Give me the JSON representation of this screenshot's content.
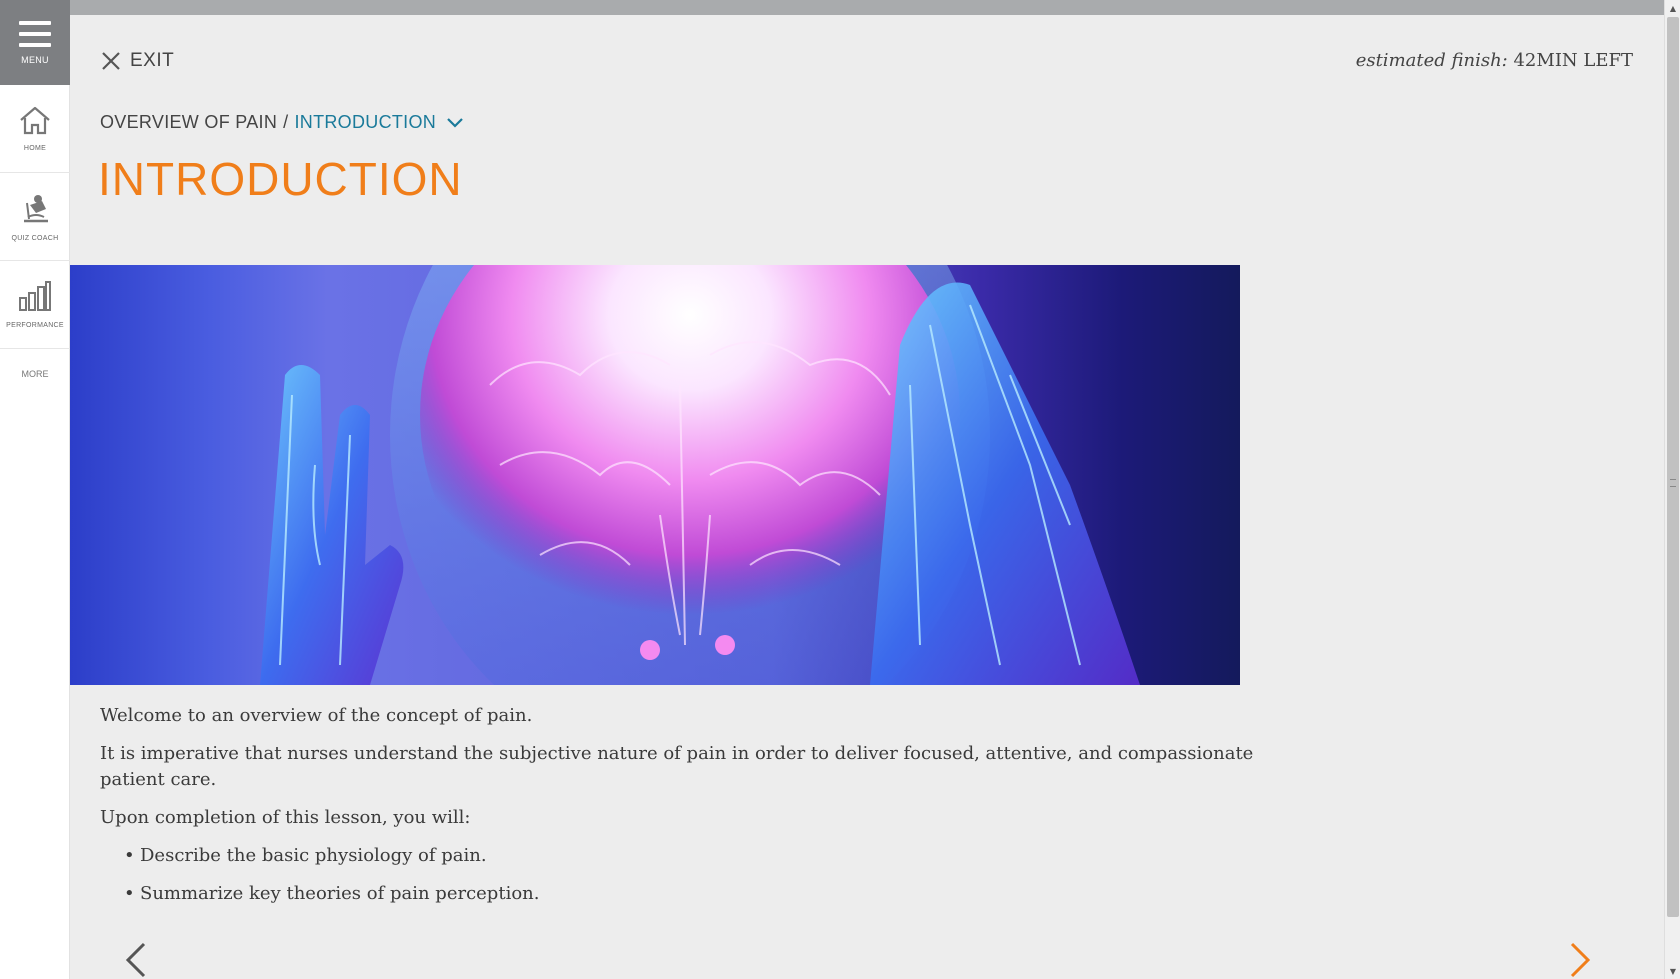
{
  "sidebar": {
    "menu_label": "MENU",
    "items": [
      {
        "label": "HOME",
        "icon": "home-icon"
      },
      {
        "label": "QUIZ COACH",
        "icon": "quiz-coach-icon"
      },
      {
        "label": "PERFORMANCE",
        "icon": "bar-chart-icon"
      }
    ],
    "more_label": "MORE"
  },
  "header": {
    "exit_label": "EXIT",
    "estimated_label": "estimated finish:",
    "time_left": "42MIN LEFT"
  },
  "breadcrumb": {
    "parent": "OVERVIEW OF PAIN",
    "separator": "/",
    "current": "INTRODUCTION"
  },
  "page": {
    "title": "INTRODUCTION",
    "paragraphs": [
      "Welcome to an overview of the concept of pain.",
      "It is imperative that nurses understand the subjective nature of pain in order to deliver focused, attentive, and compassionate patient care.",
      "Upon completion of this lesson, you will:"
    ],
    "objectives": [
      "Describe the basic physiology of pain.",
      "Summarize key theories of pain perception."
    ]
  },
  "colors": {
    "accent_orange": "#f07e1a",
    "link_teal": "#1a7a9a",
    "menu_gray": "#7d7f82"
  }
}
